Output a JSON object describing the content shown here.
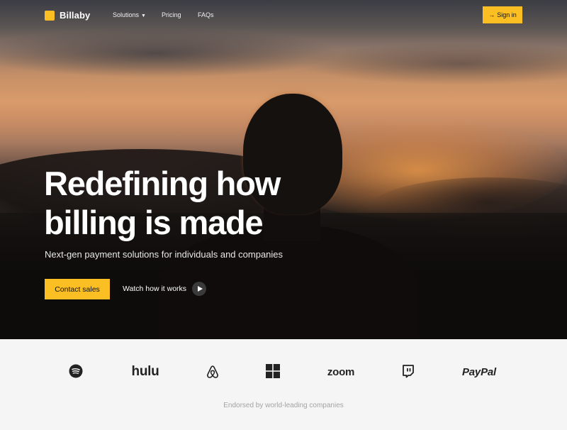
{
  "brand": {
    "name": "Billaby",
    "accent": "#fbbf24"
  },
  "nav": {
    "links": [
      {
        "label": "Solutions",
        "has_dropdown": true
      },
      {
        "label": "Pricing"
      },
      {
        "label": "FAQs"
      }
    ],
    "signin": {
      "label": "Sign in",
      "icon": "arrow-right-icon"
    }
  },
  "hero": {
    "headline_line1": "Redefining how",
    "headline_line2": "billing is made",
    "subhead": "Next-gen payment solutions for individuals and companies",
    "cta_primary": "Contact sales",
    "cta_secondary": "Watch how it works",
    "cta_secondary_icon": "play-icon"
  },
  "logos": {
    "items": [
      {
        "name": "spotify",
        "icon": "spotify-icon"
      },
      {
        "name": "hulu",
        "text": "hulu"
      },
      {
        "name": "airbnb",
        "icon": "airbnb-icon"
      },
      {
        "name": "windows",
        "icon": "windows-icon"
      },
      {
        "name": "zoom",
        "text": "zoom"
      },
      {
        "name": "twitch",
        "icon": "twitch-icon"
      },
      {
        "name": "paypal",
        "text": "PayPal"
      }
    ],
    "caption": "Endorsed by world-leading companies"
  }
}
